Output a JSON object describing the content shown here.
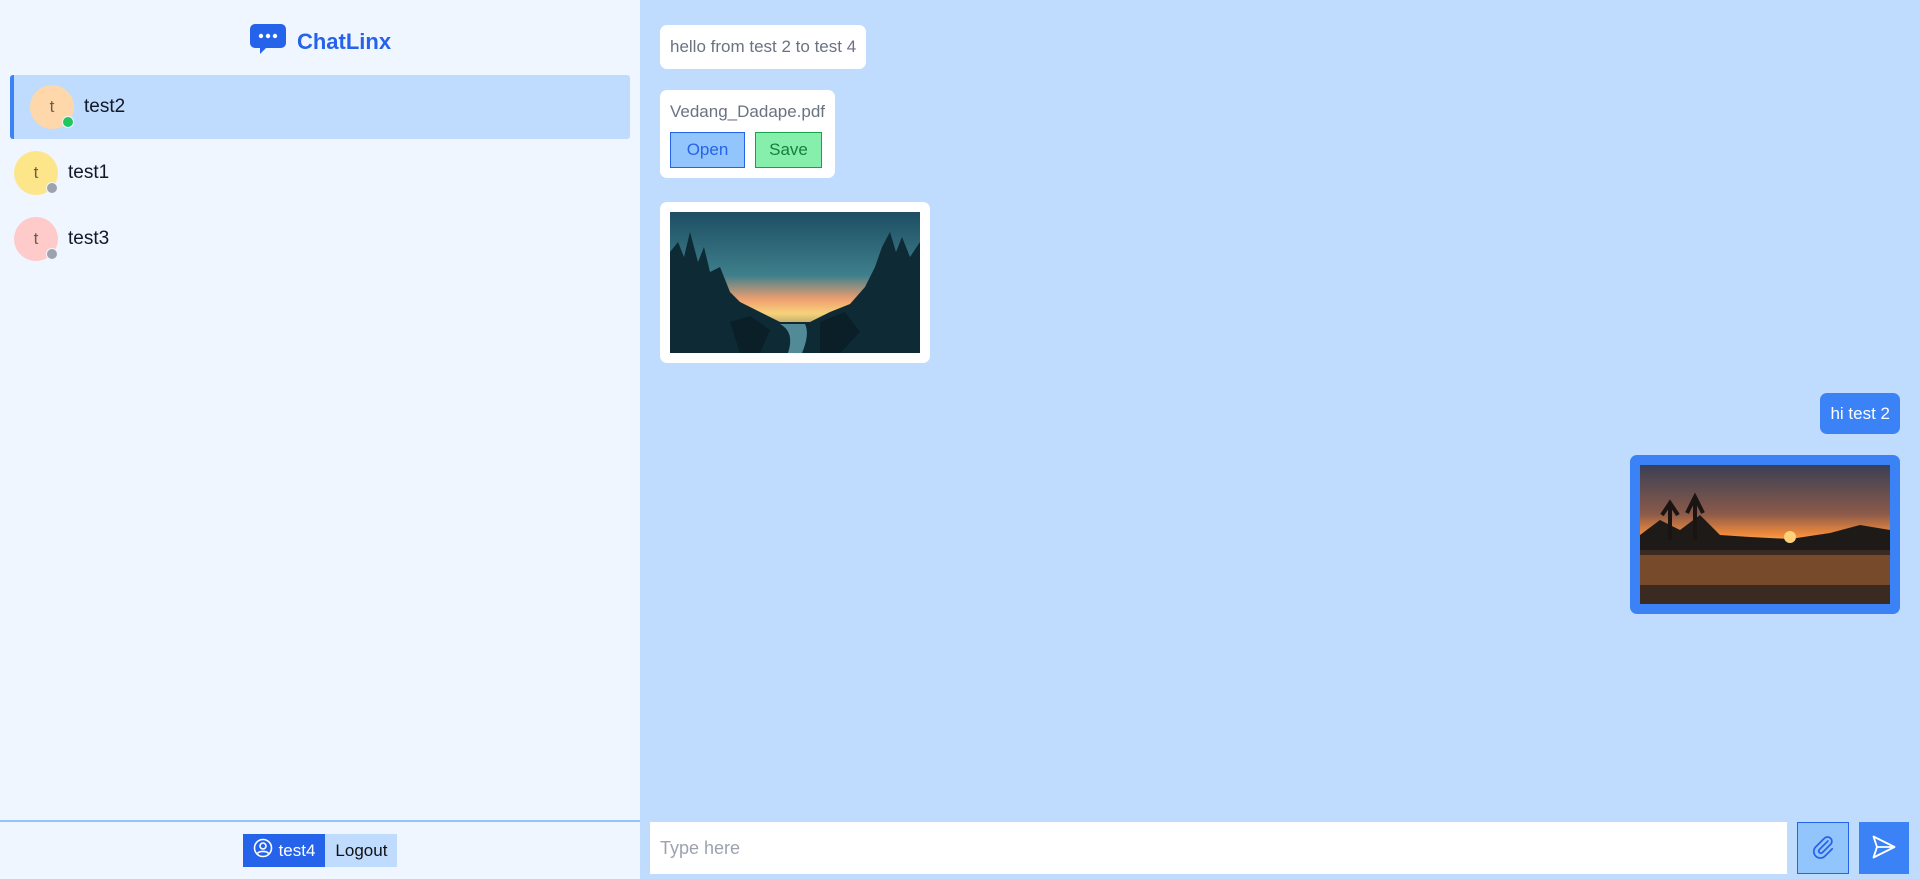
{
  "app": {
    "name": "ChatLinx",
    "brand_color": "#2563eb"
  },
  "contacts": [
    {
      "initial": "t",
      "name": "test2",
      "avatar_color": "#fed7aa",
      "online": true,
      "active": true
    },
    {
      "initial": "t",
      "name": "test1",
      "avatar_color": "#fde68a",
      "online": false,
      "active": false
    },
    {
      "initial": "t",
      "name": "test3",
      "avatar_color": "#fecaca",
      "online": false,
      "active": false
    }
  ],
  "status_colors": {
    "online": "#22c55e",
    "offline": "#9ca3af"
  },
  "footer": {
    "username": "test4",
    "logout_label": "Logout"
  },
  "messages": {
    "incoming_text": "hello from test 2 to test 4",
    "file": {
      "name": "Vedang_Dadape.pdf",
      "open_label": "Open",
      "save_label": "Save"
    },
    "outgoing_text": "hi test 2"
  },
  "composer": {
    "placeholder": "Type here"
  }
}
